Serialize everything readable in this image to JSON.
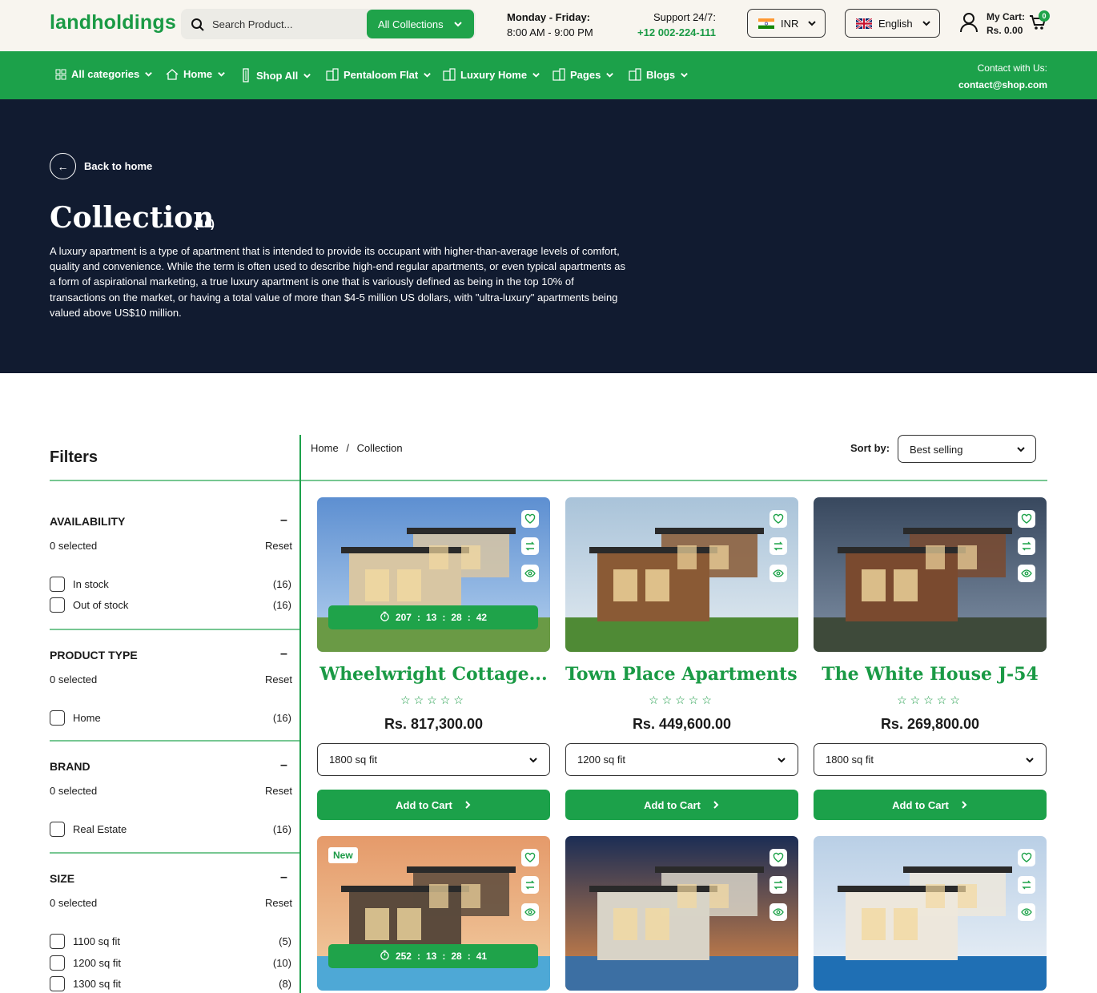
{
  "brand": {
    "logo": "landholdings",
    "accent": "#1ca14a",
    "dark_bg": "#111b30"
  },
  "header": {
    "search_placeholder": "Search Product...",
    "collections_dropdown": "All Collections",
    "hours_title": "Monday - Friday:",
    "hours_time": "8:00 AM - 9:00 PM",
    "support_title": "Support 24/7:",
    "support_phone": "+12 002-224-111",
    "currency": "INR",
    "language": "English",
    "cart_label": "My Cart:",
    "cart_total": "Rs. 0.00",
    "cart_count": "0"
  },
  "nav": {
    "items": [
      {
        "label": "All categories",
        "icon": "grid-icon"
      },
      {
        "label": "Home",
        "icon": "house-icon"
      },
      {
        "label": "Shop All",
        "icon": "tower-icon"
      },
      {
        "label": "Pentaloom Flat",
        "icon": "building-icon"
      },
      {
        "label": "Luxury Home",
        "icon": "building-icon"
      },
      {
        "label": "Pages",
        "icon": "building-icon"
      },
      {
        "label": "Blogs",
        "icon": "building-icon"
      }
    ],
    "contact_label": "Contact with Us:",
    "contact_email": "contact@shop.com"
  },
  "hero": {
    "back_label": "Back to home",
    "title": "Collection",
    "count": "(16)",
    "description": "A luxury apartment is a type of apartment that is intended to provide its occupant with higher-than-average levels of comfort, quality and convenience. While the term is often used to describe high-end regular apartments, or even typical apartments as a form of aspirational marketing, a true luxury apartment is one that is variously defined as being in the top 10% of transactions on the market, or having a total value of more than $4-5 million US dollars, with \"ultra-luxury\" apartments being valued above US$10 million."
  },
  "filters": {
    "heading": "Filters",
    "groups": [
      {
        "title": "AVAILABILITY",
        "selected": "0 selected",
        "reset": "Reset",
        "options": [
          {
            "label": "In stock",
            "count": "(16)"
          },
          {
            "label": "Out of stock",
            "count": "(16)"
          }
        ]
      },
      {
        "title": "PRODUCT TYPE",
        "selected": "0 selected",
        "reset": "Reset",
        "options": [
          {
            "label": "Home",
            "count": "(16)"
          }
        ]
      },
      {
        "title": "BRAND",
        "selected": "0 selected",
        "reset": "Reset",
        "options": [
          {
            "label": "Real Estate",
            "count": "(16)"
          }
        ]
      },
      {
        "title": "SIZE",
        "selected": "0 selected",
        "reset": "Reset",
        "options": [
          {
            "label": "1100 sq fit",
            "count": "(5)"
          },
          {
            "label": "1200 sq fit",
            "count": "(10)"
          },
          {
            "label": "1300 sq fit",
            "count": "(8)"
          }
        ]
      }
    ]
  },
  "toolbar": {
    "breadcrumb_home": "Home",
    "breadcrumb_sep": "/",
    "breadcrumb_current": "Collection",
    "sort_label": "Sort by:",
    "sort_value": "Best selling"
  },
  "products": [
    {
      "name": "Wheelwright Cottage...",
      "price": "Rs. 817,300.00",
      "variant": "1800 sq fit",
      "cta": "Add to Cart",
      "timer": [
        "207",
        "13",
        "28",
        "42"
      ],
      "badge": ""
    },
    {
      "name": "Town Place Apartments ...",
      "price": "Rs. 449,600.00",
      "variant": "1200 sq fit",
      "cta": "Add to Cart",
      "timer": null,
      "badge": ""
    },
    {
      "name": "The White House J-54",
      "price": "Rs. 269,800.00",
      "variant": "1800 sq fit",
      "cta": "Add to Cart",
      "timer": null,
      "badge": ""
    },
    {
      "name": "",
      "price": "",
      "variant": "",
      "cta": "",
      "timer": [
        "252",
        "13",
        "28",
        "41"
      ],
      "badge": "New"
    },
    {
      "name": "",
      "price": "",
      "variant": "",
      "cta": "",
      "timer": null,
      "badge": ""
    },
    {
      "name": "",
      "price": "",
      "variant": "",
      "cta": "",
      "timer": null,
      "badge": ""
    }
  ],
  "rating_stars": "☆☆☆☆☆"
}
